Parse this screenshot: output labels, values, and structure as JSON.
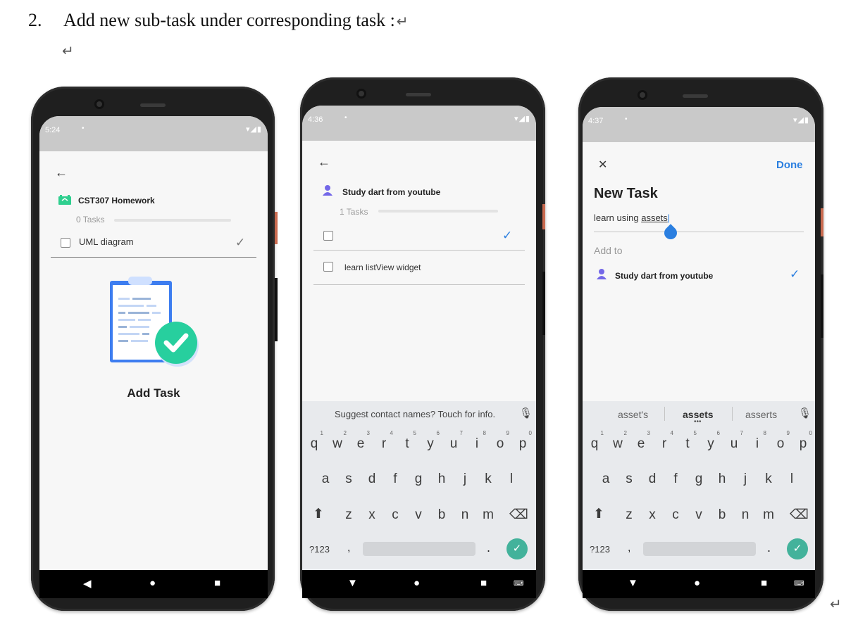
{
  "doc": {
    "number": "2.",
    "heading": "Add new sub-task under corresponding task :",
    "return_mark": "↵"
  },
  "phone1": {
    "time": "5:24",
    "project_title": "CST307 Homework",
    "task_count": "0 Tasks",
    "task_item": "UML diagram",
    "empty_label": "Add Task",
    "project_icon_color": "#2fcf8f"
  },
  "phone2": {
    "time": "4:36",
    "project_title": "Study dart from youtube",
    "task_count": "1 Tasks",
    "task_item": "learn listView widget",
    "keyboard_suggestion": "Suggest contact names? Touch for info."
  },
  "phone3": {
    "time": "4:37",
    "close_label": "✕",
    "done_label": "Done",
    "heading": "New Task",
    "input_text": "learn using ",
    "input_word": "assets",
    "add_to_label": "Add to",
    "project_title": "Study dart from youtube",
    "suggestions": [
      "asset's",
      "assets",
      "asserts"
    ]
  },
  "keyboard": {
    "row1": [
      "q",
      "w",
      "e",
      "r",
      "t",
      "y",
      "u",
      "i",
      "o",
      "p"
    ],
    "row1_nums": [
      "1",
      "2",
      "3",
      "4",
      "5",
      "6",
      "7",
      "8",
      "9",
      "0"
    ],
    "row2": [
      "a",
      "s",
      "d",
      "f",
      "g",
      "h",
      "j",
      "k",
      "l"
    ],
    "row3": [
      "z",
      "x",
      "c",
      "v",
      "b",
      "n",
      "m"
    ],
    "symbols": "?123",
    "comma": ",",
    "period": "."
  },
  "colors": {
    "accent_blue": "#2b7fe0",
    "avatar_purple": "#7367e8",
    "keyboard_enter": "#43b29b"
  }
}
